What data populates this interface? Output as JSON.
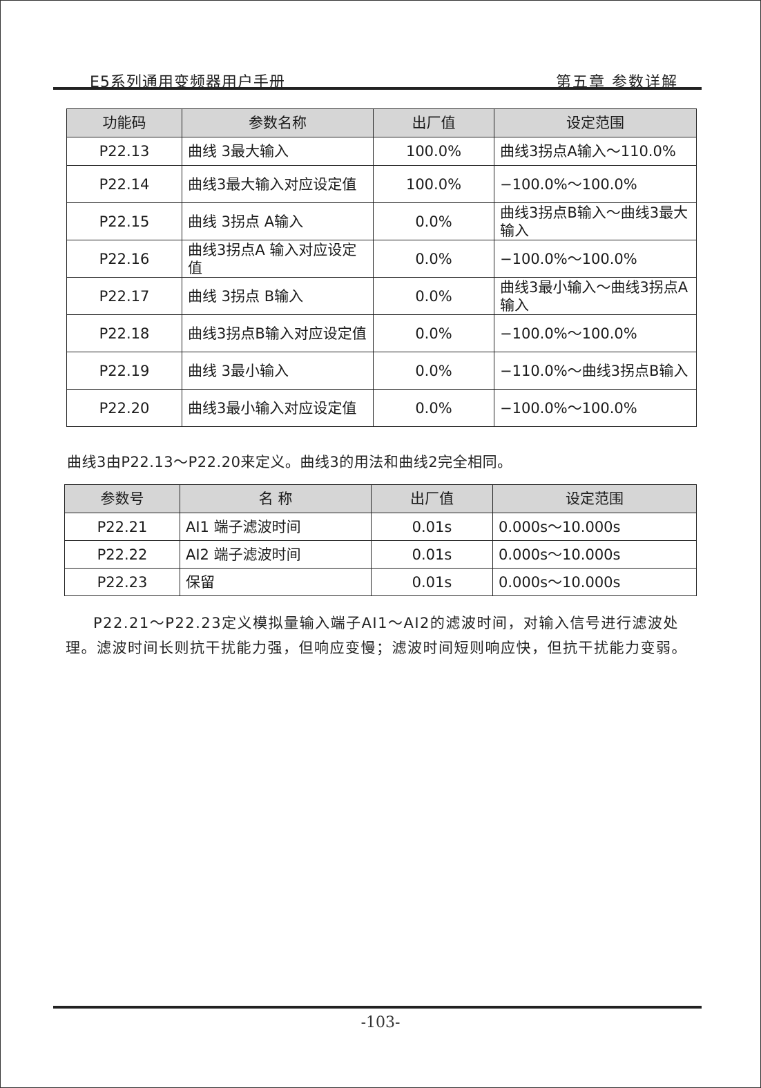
{
  "header": {
    "left": "E5系列通用变频器用户手册",
    "right": "第五章 参数详解"
  },
  "table1": {
    "headers": [
      "功能码",
      "参数名称",
      "出厂值",
      "设定范围"
    ],
    "rows": [
      {
        "code": "P22.13",
        "name": "曲线 3最大输入",
        "default": "100.0%",
        "range": "曲线3拐点A输入～110.0%"
      },
      {
        "code": "P22.14",
        "name": "曲线3最大输入对应设定值",
        "default": "100.0%",
        "range": "−100.0%～100.0%"
      },
      {
        "code": "P22.15",
        "name": "曲线 3拐点 A输入",
        "default": "0.0%",
        "range": "曲线3拐点B输入～曲线3最大输入"
      },
      {
        "code": "P22.16",
        "name": "曲线3拐点A 输入对应设定值",
        "default": "0.0%",
        "range": "−100.0%～100.0%"
      },
      {
        "code": "P22.17",
        "name": "曲线 3拐点 B输入",
        "default": "0.0%",
        "range": "曲线3最小输入～曲线3拐点A 输入"
      },
      {
        "code": "P22.18",
        "name": "曲线3拐点B输入对应设定值",
        "default": "0.0%",
        "range": "−100.0%～100.0%"
      },
      {
        "code": "P22.19",
        "name": "曲线 3最小输入",
        "default": "0.0%",
        "range": "−110.0%～曲线3拐点B输入"
      },
      {
        "code": "P22.20",
        "name": "曲线3最小输入对应设定值",
        "default": "0.0%",
        "range": "−100.0%～100.0%"
      }
    ]
  },
  "paragraph1": "曲线3由P22.13～P22.20来定义。曲线3的用法和曲线2完全相同。",
  "table2": {
    "headers": [
      "参数号",
      "名 称",
      "出厂值",
      "设定范围"
    ],
    "rows": [
      {
        "code": "P22.21",
        "name": "AI1 端子滤波时间",
        "default": "0.01s",
        "range": "0.000s～10.000s"
      },
      {
        "code": "P22.22",
        "name": "AI2 端子滤波时间",
        "default": "0.01s",
        "range": "0.000s～10.000s"
      },
      {
        "code": "P22.23",
        "name": "保留",
        "default": "0.01s",
        "range": "0.000s～10.000s"
      }
    ]
  },
  "paragraph2": "P22.21～P22.23定义模拟量输入端子AI1～AI2的滤波时间，对输入信号进行滤波处理。滤波时间长则抗干扰能力强，但响应变慢；滤波时间短则响应快，但抗干扰能力变弱。",
  "footer": {
    "page_number": "-103-"
  }
}
